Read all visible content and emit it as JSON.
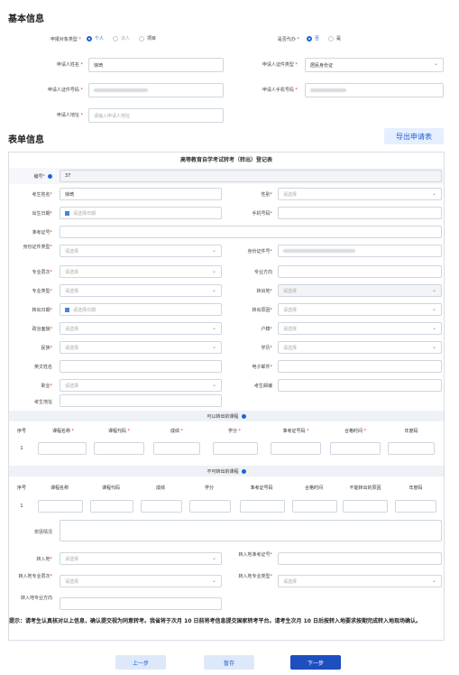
{
  "basic": {
    "title": "基本信息",
    "applicant_type_label": "申报对象类型",
    "applicant_type_options": [
      "个人",
      "法人",
      "项目"
    ],
    "agent_label": "是否代办",
    "agent_options": [
      "否",
      "是"
    ],
    "name_label": "申请人姓名",
    "name_value": "徐琦",
    "id_type_label": "申请人证件类型",
    "id_type_value": "居民身份证",
    "id_no_label": "申请人证件号码",
    "phone_label": "申请人手机号码",
    "address_label": "申请人地址",
    "address_placeholder": "请输入申请人地址"
  },
  "form": {
    "title": "表单信息",
    "export_label": "导出申请表",
    "table_title": "高等教育自学考试转考（转出）登记表",
    "serial_label": "编号",
    "serial_value": "37",
    "select_ph": "请选择",
    "date_ph": "请选择日期",
    "fields": {
      "name": "考生姓名",
      "name_value": "徐琦",
      "gender": "性别",
      "birth": "出生日期",
      "mobile": "手机号码",
      "ticket": "准考证号",
      "idtype": "身份证件类型",
      "idno": "身份证件号",
      "level": "专业层次",
      "direction": "专业方向",
      "mtype": "专业类型",
      "outarea": "转出地",
      "outdate": "转出日期",
      "reason": "转出原因",
      "politics": "政治面貌",
      "hukou": "户籍",
      "nation": "民族",
      "edu": "学历",
      "ename": "英文姓名",
      "email": "电子邮件",
      "job": "职业",
      "postcode": "考生邮编",
      "addr": "考生地址"
    },
    "transfer_ok": {
      "title": "可以转出的课程",
      "headers": [
        "序号",
        "课程名称",
        "课程代码",
        "成绩",
        "学分",
        "准考证号码",
        "合格时间",
        "年度码"
      ],
      "row_no": "1"
    },
    "transfer_no": {
      "title": "不可转出的课程",
      "headers": [
        "序号",
        "课程名称",
        "课程代码",
        "成绩",
        "学分",
        "准考证号码",
        "合格时间",
        "不能转出的原因",
        "年度码"
      ],
      "row_no": "1"
    },
    "reward": "奖惩情况",
    "in_area": "转入地",
    "in_ticket": "转入地准考证号",
    "in_level": "转入地专业层次",
    "in_mtype": "转入地专业类型",
    "in_direction": "转入地专业方向",
    "notice": "提示：请考生认真核对以上信息，确认提交视为同意转考。我省将于次月 10 日前将考信息提交国家转考平台。请考生次月 10 日后按转入地要求按期完成转入地现场确认。"
  },
  "buttons": {
    "prev": "上一步",
    "save": "暂存",
    "next": "下一步"
  },
  "colors": {
    "accent": "#1e63d6",
    "required": "#e33333"
  }
}
